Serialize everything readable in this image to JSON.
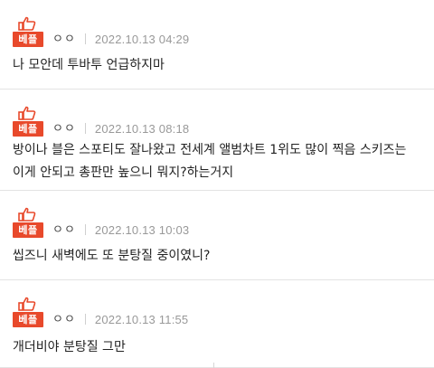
{
  "colors": {
    "badge_bg": "#e8492b",
    "badge_text": "#ffffff",
    "date_text": "#999999",
    "body_text": "#222222",
    "divider": "#e3e3e3"
  },
  "comments": [
    {
      "badge_label": "베플",
      "badge_icon": "thumbs-up-icon",
      "author": "ㅇㅇ",
      "date": "2022.10.13 04:29",
      "text": "나 모안데 투바투 언급하지마"
    },
    {
      "badge_label": "베플",
      "badge_icon": "thumbs-up-icon",
      "author": "ㅇㅇ",
      "date": "2022.10.13 08:18",
      "text": "방이나 블은 스포티도 잘나왔고 전세계 앨범차트 1위도 많이 찍음 스키즈는 이게 안되고 총판만 높으니 뭐지?하는거지"
    },
    {
      "badge_label": "베플",
      "badge_icon": "thumbs-up-icon",
      "author": "ㅇㅇ",
      "date": "2022.10.13 10:03",
      "text": "씹즈니 새벽에도 또 분탕질 중이였니?"
    },
    {
      "badge_label": "베플",
      "badge_icon": "thumbs-up-icon",
      "author": "ㅇㅇ",
      "date": "2022.10.13 11:55",
      "text": "개더비야 분탕질 그만"
    }
  ]
}
